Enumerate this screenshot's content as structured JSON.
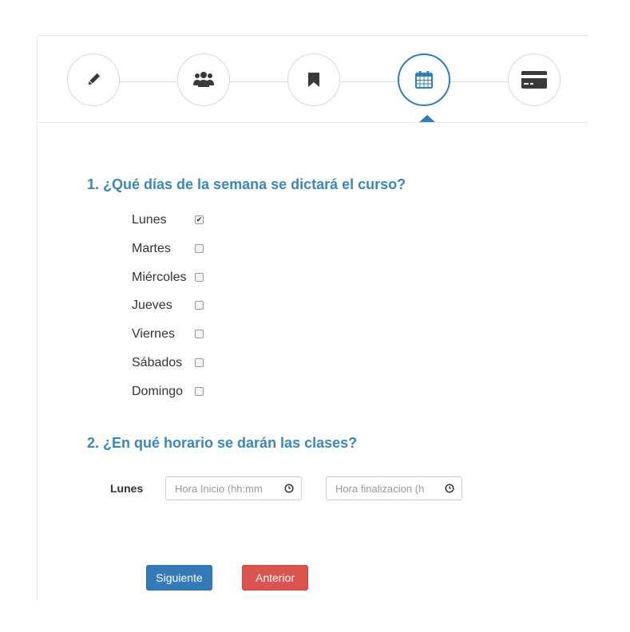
{
  "stepper": {
    "steps": [
      {
        "icon": "pencil-icon",
        "active": false
      },
      {
        "icon": "users-icon",
        "active": false
      },
      {
        "icon": "bookmark-icon",
        "active": false
      },
      {
        "icon": "calendar-icon",
        "active": true
      },
      {
        "icon": "credit-card-icon",
        "active": false
      }
    ]
  },
  "colors": {
    "accent": "#3b87b8",
    "primary": "#337ab7",
    "danger": "#d9534f"
  },
  "question1": {
    "title": "1. ¿Qué días de la semana se dictará el curso?",
    "days": [
      {
        "label": "Lunes",
        "checked": true
      },
      {
        "label": "Martes",
        "checked": false
      },
      {
        "label": "Miércoles",
        "checked": false
      },
      {
        "label": "Jueves",
        "checked": false
      },
      {
        "label": "Viernes",
        "checked": false
      },
      {
        "label": "Sábados",
        "checked": false
      },
      {
        "label": "Domingo",
        "checked": false
      }
    ]
  },
  "question2": {
    "title": "2. ¿En qué horario se darán las clases?",
    "rows": [
      {
        "day": "Lunes",
        "start_placeholder": "Hora Inicio (hh:mm",
        "end_placeholder": "Hora finalizacion (h"
      }
    ]
  },
  "buttons": {
    "next": "Siguiente",
    "previous": "Anterior"
  }
}
